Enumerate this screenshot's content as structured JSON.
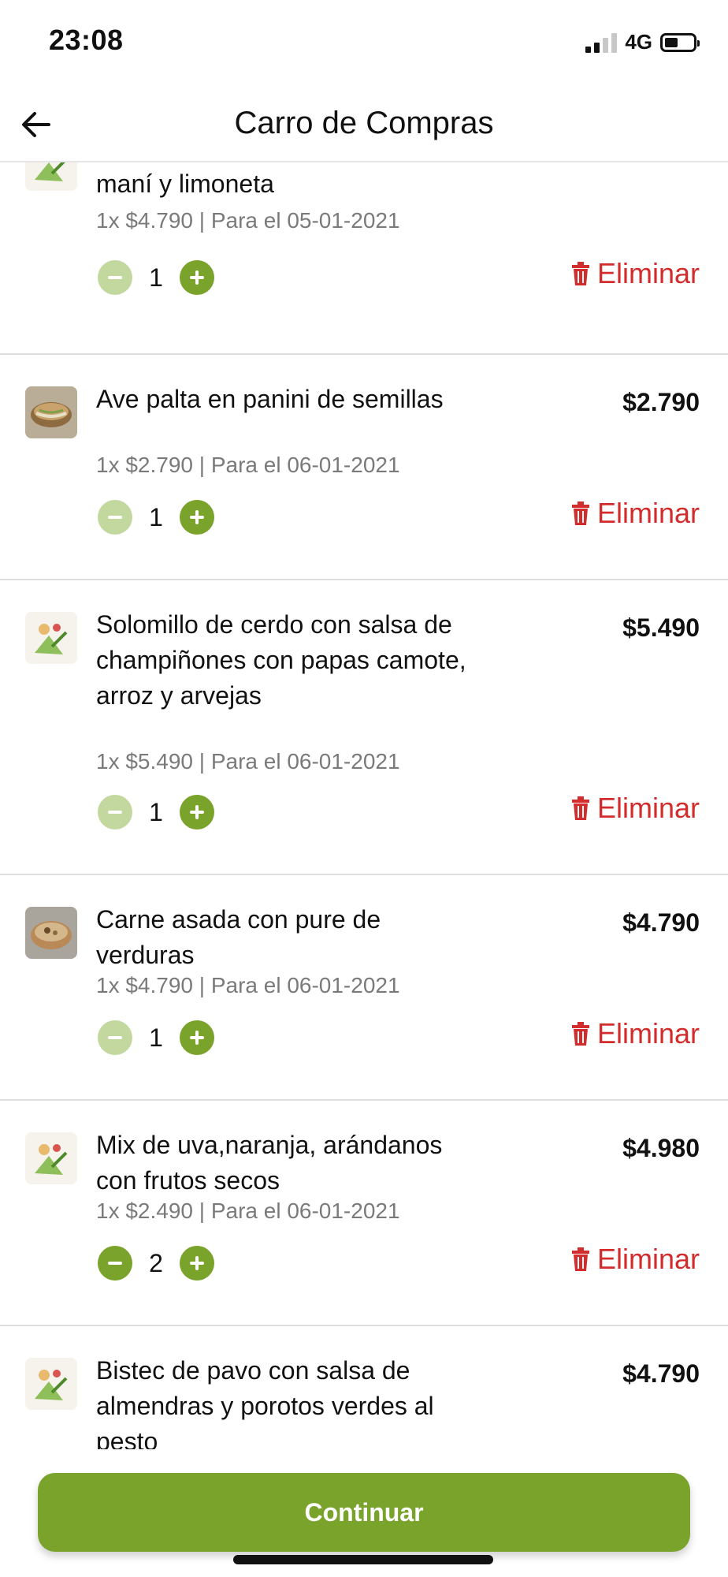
{
  "status_bar": {
    "time": "23:08",
    "network": "4G"
  },
  "header": {
    "title": "Carro de Compras"
  },
  "items": [
    {
      "name": "ensalada de repollo, zanahoria, maní y limoneta",
      "price": "",
      "meta": "1x $4.790 | Para el 05-01-2021",
      "qty": "1",
      "thumb": "salad-illustration"
    },
    {
      "name": "Ave palta en panini de semillas",
      "price": "$2.790",
      "meta": "1x $2.790 | Para el 06-01-2021",
      "qty": "1",
      "thumb": "sandwich-photo"
    },
    {
      "name": "Solomillo de cerdo con salsa de champiñones con papas camote, arroz y arvejas",
      "price": "$5.490",
      "meta": "1x $5.490 | Para el 06-01-2021",
      "qty": "1",
      "thumb": "salad-illustration"
    },
    {
      "name": "Carne asada con pure de verduras",
      "price": "$4.790",
      "meta": "1x $4.790 | Para el 06-01-2021",
      "qty": "1",
      "thumb": "bowl-photo"
    },
    {
      "name": "Mix de uva,naranja, arándanos con frutos secos",
      "price": "$4.980",
      "meta": "1x $2.490 | Para el 06-01-2021",
      "qty": "2",
      "thumb": "salad-illustration"
    },
    {
      "name": "Bistec de pavo con salsa de almendras y porotos verdes al pesto",
      "price": "$4.790",
      "meta": "",
      "qty": "",
      "thumb": "salad-illustration"
    }
  ],
  "delete_label": "Eliminar",
  "continue_label": "Continuar",
  "colors": {
    "accent": "#7aa32b",
    "accent_light": "#c3d89f",
    "danger": "#d22c2c",
    "meta": "#7a7a7a"
  }
}
